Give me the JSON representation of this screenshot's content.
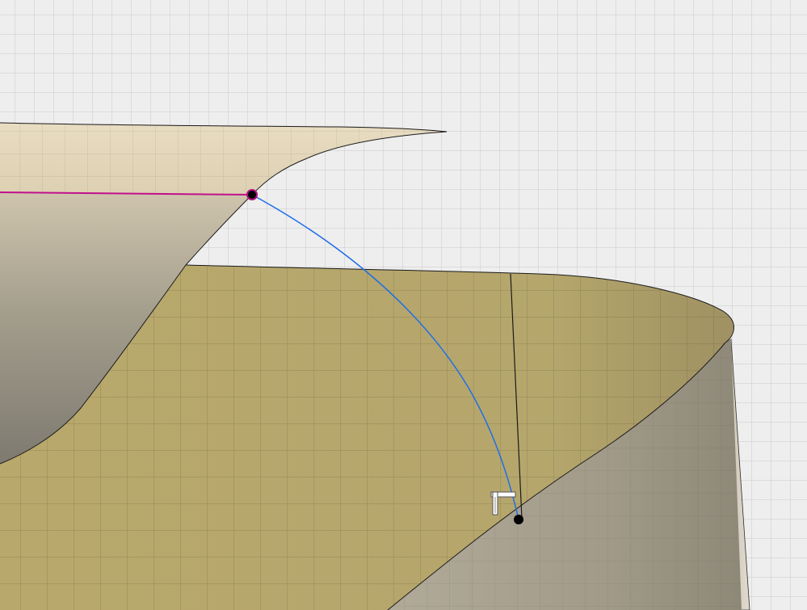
{
  "viewport": {
    "background": "#eeeeee",
    "grid_color": "#c9c9c9",
    "surface_colors": {
      "upper_light": "#e6d9bd",
      "upper_shadow": "#8f8b7c",
      "lower_top": "#b9a86a",
      "lower_side": "#a49d8c",
      "back_side": "#d4cdbf"
    },
    "curve_colors": {
      "edge": "#1a1a1a",
      "selected_edge": "#c0108c",
      "sketch_arc": "#1f6fe8",
      "endpoint": "#000000"
    }
  }
}
